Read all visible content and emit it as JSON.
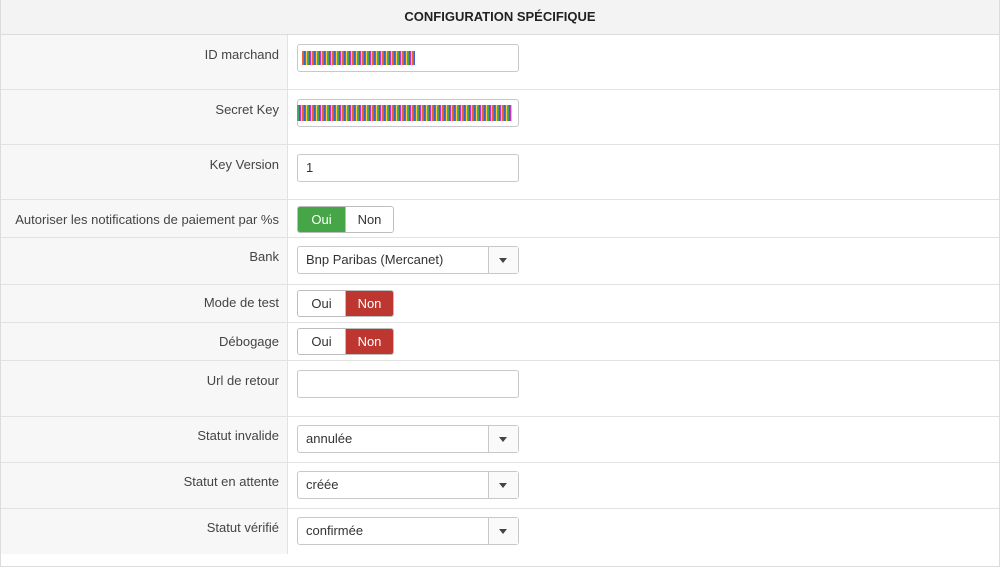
{
  "header": {
    "title": "CONFIGURATION SPÉCIFIQUE"
  },
  "fields": {
    "merchant_id": {
      "label": "ID marchand"
    },
    "secret_key": {
      "label": "Secret Key"
    },
    "key_version": {
      "label": "Key Version",
      "value": "1"
    },
    "notifications": {
      "label": "Autoriser les notifications de paiement par %s",
      "yes": "Oui",
      "no": "Non",
      "selected": "Oui"
    },
    "bank": {
      "label": "Bank",
      "value": "Bnp Paribas (Mercanet)"
    },
    "test_mode": {
      "label": "Mode de test",
      "yes": "Oui",
      "no": "Non",
      "selected": "Non"
    },
    "debug": {
      "label": "Débogage",
      "yes": "Oui",
      "no": "Non",
      "selected": "Non"
    },
    "return_url": {
      "label": "Url de retour",
      "value": ""
    },
    "status_invalid": {
      "label": "Statut invalide",
      "value": "annulée"
    },
    "status_pending": {
      "label": "Statut en attente",
      "value": "créée"
    },
    "status_verified": {
      "label": "Statut vérifié",
      "value": "confirmée"
    }
  },
  "colors": {
    "toggle_yes": "#46a546",
    "toggle_no": "#bd362f"
  }
}
